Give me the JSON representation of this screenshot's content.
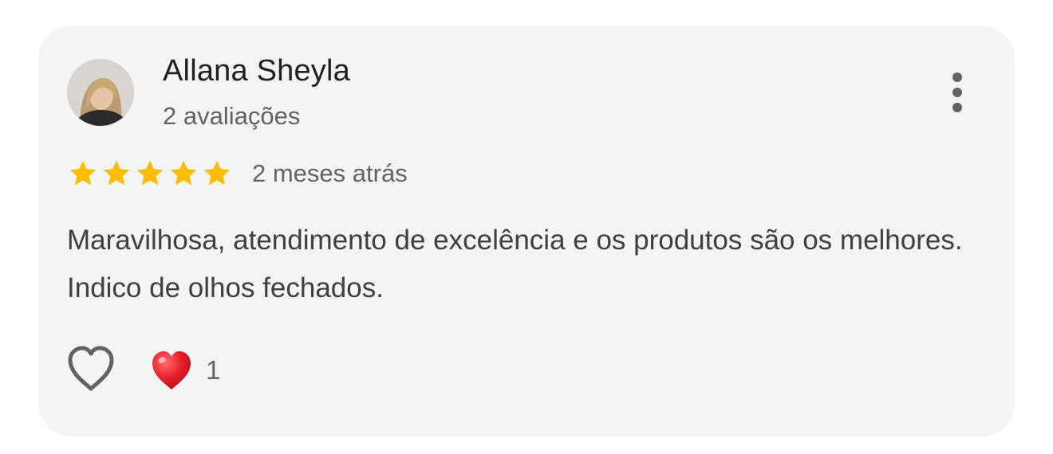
{
  "review": {
    "author_name": "Allana Sheyla",
    "author_reviews": "2 avaliações",
    "rating": 5,
    "rating_max": 5,
    "date": "2 meses atrás",
    "text": "Maravilhosa, atendimento de excelência e os produtos são os melhores. Indico de olhos fechados.",
    "reaction_count": "1"
  },
  "icons": {
    "avatar": "user-photo",
    "more": "more-vert-icon",
    "star": "star-icon",
    "like": "heart-outline-icon",
    "reaction": "red-heart-icon"
  },
  "colors": {
    "card_background": "#f2f4f5",
    "star": "#fbbc04",
    "heart_reaction": "#e0202a",
    "secondary_text": "#5f6368"
  }
}
